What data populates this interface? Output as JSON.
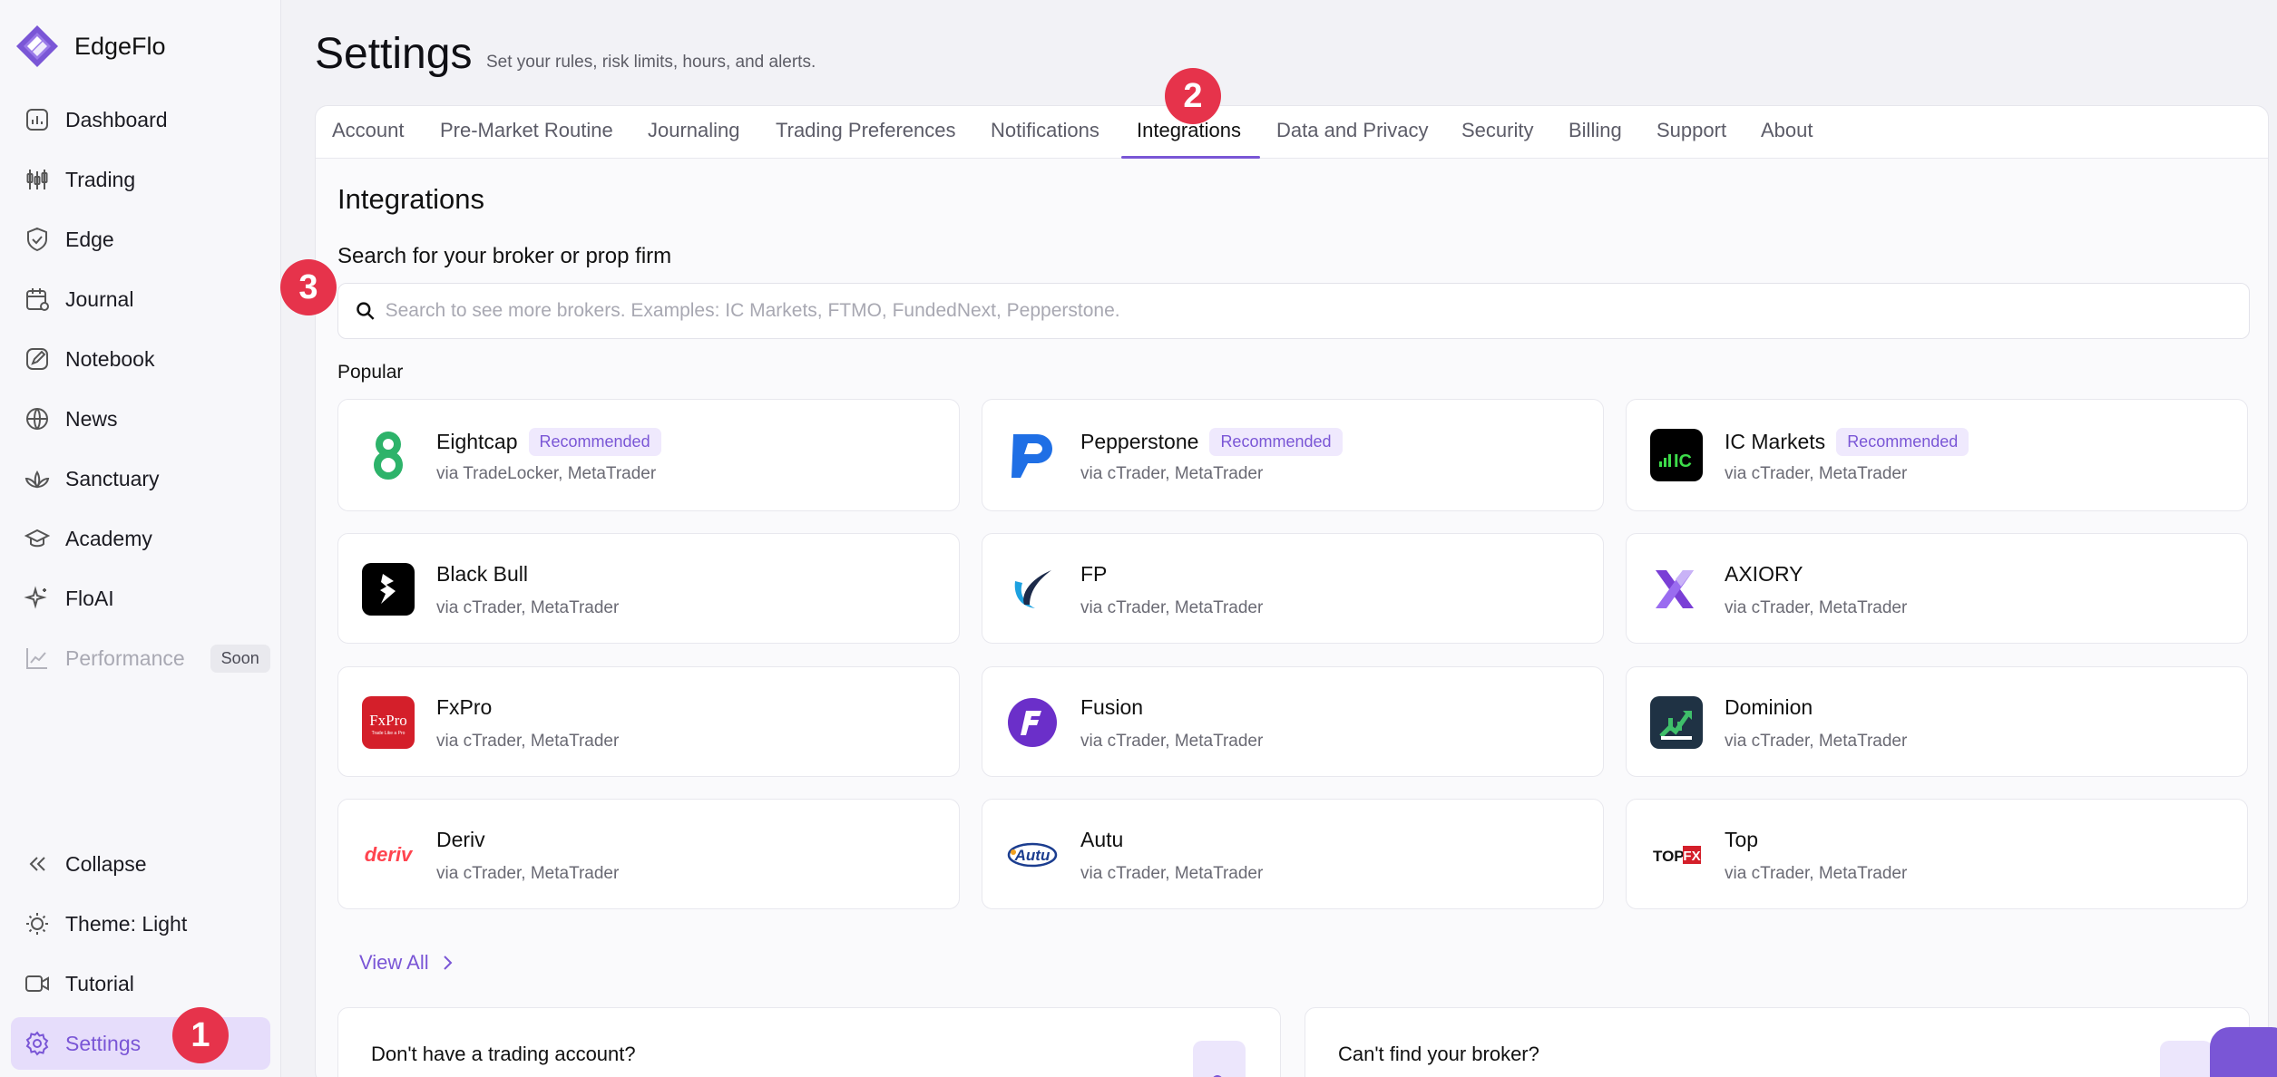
{
  "app": {
    "name": "EdgeFlo",
    "accent": "#7a56d6"
  },
  "sidebar": {
    "items": [
      {
        "label": "Dashboard",
        "icon": "bar-chart-icon"
      },
      {
        "label": "Trading",
        "icon": "candlestick-icon"
      },
      {
        "label": "Edge",
        "icon": "shield-check-icon"
      },
      {
        "label": "Journal",
        "icon": "calendar-icon"
      },
      {
        "label": "Notebook",
        "icon": "pencil-icon"
      },
      {
        "label": "News",
        "icon": "globe-icon"
      },
      {
        "label": "Sanctuary",
        "icon": "lotus-icon"
      },
      {
        "label": "Academy",
        "icon": "graduation-cap-icon"
      },
      {
        "label": "FloAI",
        "icon": "sparkle-icon"
      },
      {
        "label": "Performance",
        "icon": "line-chart-icon",
        "badge": "Soon",
        "disabled": true
      }
    ],
    "bottom": [
      {
        "label": "Collapse",
        "icon": "double-chevron-left-icon"
      },
      {
        "label": "Theme: Light",
        "icon": "sun-icon"
      },
      {
        "label": "Tutorial",
        "icon": "video-icon"
      },
      {
        "label": "Settings",
        "icon": "gear-icon",
        "active": true
      }
    ]
  },
  "header": {
    "title": "Settings",
    "subtitle": "Set your rules, risk limits, hours, and alerts."
  },
  "tabs": [
    "Account",
    "Pre-Market Routine",
    "Journaling",
    "Trading Preferences",
    "Notifications",
    "Integrations",
    "Data and Privacy",
    "Security",
    "Billing",
    "Support",
    "About"
  ],
  "active_tab": "Integrations",
  "integrations": {
    "title": "Integrations",
    "search_label": "Search for your broker or prop firm",
    "search_placeholder": "Search to see more brokers. Examples: IC Markets, FTMO, FundedNext, Pepperstone.",
    "popular_label": "Popular",
    "brokers": [
      {
        "name": "Eightcap",
        "badge": "Recommended",
        "via": "via TradeLocker, MetaTrader"
      },
      {
        "name": "Pepperstone",
        "badge": "Recommended",
        "via": "via cTrader, MetaTrader"
      },
      {
        "name": "IC Markets",
        "badge": "Recommended",
        "via": "via cTrader, MetaTrader"
      },
      {
        "name": "Black Bull",
        "via": "via cTrader, MetaTrader"
      },
      {
        "name": "FP",
        "via": "via cTrader, MetaTrader"
      },
      {
        "name": "AXIORY",
        "via": "via cTrader, MetaTrader"
      },
      {
        "name": "FxPro",
        "via": "via cTrader, MetaTrader"
      },
      {
        "name": "Fusion",
        "via": "via cTrader, MetaTrader"
      },
      {
        "name": "Dominion",
        "via": "via cTrader, MetaTrader"
      },
      {
        "name": "Deriv",
        "via": "via cTrader, MetaTrader"
      },
      {
        "name": "Autu",
        "via": "via cTrader, MetaTrader"
      },
      {
        "name": "Top",
        "via": "via cTrader, MetaTrader"
      }
    ],
    "logo_text": {
      "ic": "IC",
      "fxpro": "FxPro",
      "fxpro_tag": "Trade Like a Pro",
      "deriv": "deriv",
      "autu": "Autu",
      "top": "TOP",
      "fx": "FX"
    },
    "view_all": "View All",
    "no_account": {
      "title": "Don't have a trading account?"
    },
    "cant_find": {
      "title": "Can't find your broker?"
    }
  },
  "markers": [
    "1",
    "2",
    "3"
  ]
}
